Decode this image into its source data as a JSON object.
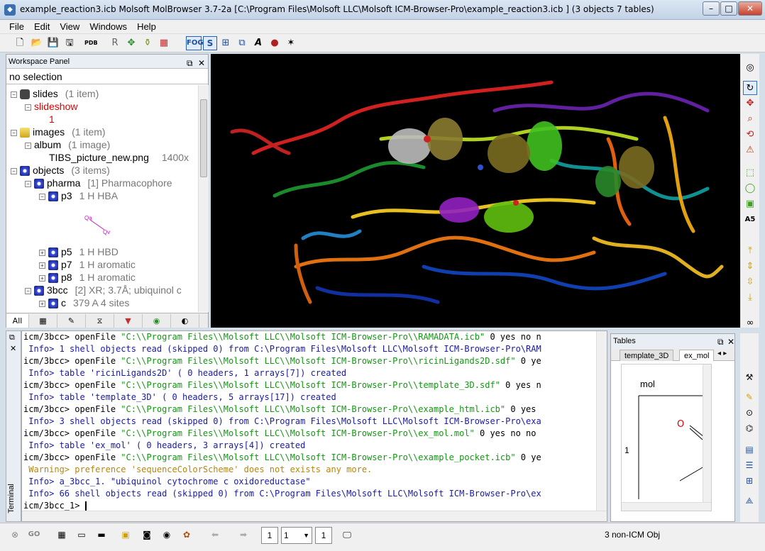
{
  "window": {
    "title": "example_reaction3.icb  Molsoft MolBrowser 3.7-2a  [C:\\Program Files\\Molsoft LLC\\Molsoft ICM-Browser-Pro\\example_reaction3.icb ] (3 objects 7 tables)"
  },
  "menu": [
    "File",
    "Edit",
    "View",
    "Windows",
    "Help"
  ],
  "toolbar": {
    "fog_label": "FOG",
    "s_label": "S",
    "r_label": "R"
  },
  "workspace": {
    "title": "Workspace Panel",
    "selection": "no selection",
    "tree": [
      {
        "label": "slides",
        "info": "(1 item)"
      },
      {
        "label": "slideshow",
        "info": ""
      },
      {
        "label": "1",
        "info": ""
      },
      {
        "label": "images",
        "info": "(1 item)"
      },
      {
        "label": "album",
        "info": "(1 image)"
      },
      {
        "label": "TIBS_picture_new.png",
        "info": "1400x"
      },
      {
        "label": "objects",
        "info": "(3 items)"
      },
      {
        "label": "pharma",
        "info": "[1] Pharmacophore"
      },
      {
        "label": "p3",
        "info": "1 H HBA"
      },
      {
        "label": "p5",
        "info": "1 H HBD"
      },
      {
        "label": "p7",
        "info": "1 H aromatic"
      },
      {
        "label": "p8",
        "info": "1 H aromatic"
      },
      {
        "label": "3bcc",
        "info": "[2] XR; 3.7Å; ubiquinol c"
      },
      {
        "label": "c",
        "info": "379 A  4 sites"
      }
    ],
    "pharm_labels": [
      "Qa",
      "Qv"
    ],
    "tabs": [
      "All"
    ]
  },
  "terminal": {
    "side_label": "Terminal",
    "lines": [
      {
        "type": "cmd",
        "prefix": "icm/3bcc> openFile ",
        "arg": "\"C:\\\\Program Files\\\\Molsoft LLC\\\\Molsoft ICM-Browser-Pro\\\\RAMADATA.icb\"",
        "rest": " 0 yes no n"
      },
      {
        "type": "info",
        "text": " Info> 1 shell objects read (skipped 0) from C:\\Program Files\\Molsoft LLC\\Molsoft ICM-Browser-Pro\\RAM"
      },
      {
        "type": "cmd",
        "prefix": "icm/3bcc> openFile ",
        "arg": "\"C:\\\\Program Files\\\\Molsoft LLC\\\\Molsoft ICM-Browser-Pro\\\\ricinLigands2D.sdf\"",
        "rest": " 0 ye"
      },
      {
        "type": "info",
        "text": " Info> table 'ricinLigands2D' ( 0 headers, 1 arrays[7]) created"
      },
      {
        "type": "cmd",
        "prefix": "icm/3bcc> openFile ",
        "arg": "\"C:\\\\Program Files\\\\Molsoft LLC\\\\Molsoft ICM-Browser-Pro\\\\template_3D.sdf\"",
        "rest": " 0 yes n"
      },
      {
        "type": "info",
        "text": " Info> table 'template_3D' ( 0 headers, 5 arrays[17]) created"
      },
      {
        "type": "cmd",
        "prefix": "icm/3bcc> openFile ",
        "arg": "\"C:\\\\Program Files\\\\Molsoft LLC\\\\Molsoft ICM-Browser-Pro\\\\example_html.icb\"",
        "rest": " 0 yes"
      },
      {
        "type": "info",
        "text": " Info> 3 shell objects read (skipped 0) from C:\\Program Files\\Molsoft LLC\\Molsoft ICM-Browser-Pro\\exa"
      },
      {
        "type": "cmd",
        "prefix": "icm/3bcc> openFile ",
        "arg": "\"C:\\\\Program Files\\\\Molsoft LLC\\\\Molsoft ICM-Browser-Pro\\\\ex_mol.mol\"",
        "rest": " 0 yes no no"
      },
      {
        "type": "info",
        "text": " Info> table 'ex_mol' ( 0 headers, 3 arrays[4]) created"
      },
      {
        "type": "cmd",
        "prefix": "icm/3bcc> openFile ",
        "arg": "\"C:\\\\Program Files\\\\Molsoft LLC\\\\Molsoft ICM-Browser-Pro\\\\example_pocket.icb\"",
        "rest": " 0 ye"
      },
      {
        "type": "warn",
        "text": " Warning> preference 'sequenceColorScheme' does not exists any more."
      },
      {
        "type": "info",
        "text": " Info> a_3bcc_1. \"ubiquinol cytochrome c oxidoreductase\""
      },
      {
        "type": "info",
        "text": " Info> 66 shell objects read (skipped 0) from C:\\Program Files\\Molsoft LLC\\Molsoft ICM-Browser-Pro\\ex"
      },
      {
        "type": "prompt",
        "text": "icm/3bcc_1> "
      }
    ]
  },
  "tables": {
    "title": "Tables",
    "tabs": [
      "template_3D",
      "ex_mol"
    ],
    "active_tab": "ex_mol",
    "column": "mol",
    "row_index": "1",
    "atom_label": "O"
  },
  "status": {
    "page_a": "1",
    "page_b": "1",
    "page_c": "1",
    "message": "3 non-ICM Obj"
  }
}
